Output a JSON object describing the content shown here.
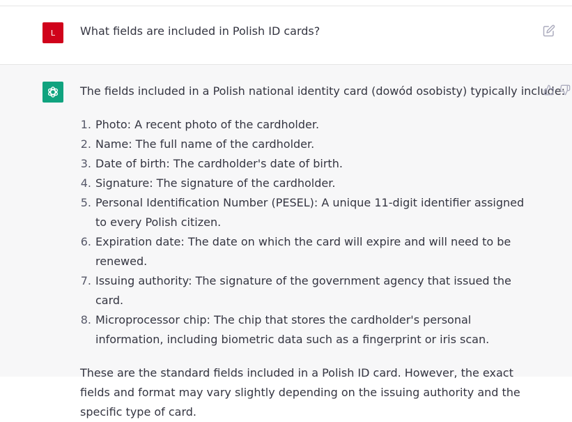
{
  "user_message": {
    "avatar_letter": "L",
    "avatar_color": "#d0021b",
    "text": "What fields are included in Polish ID cards?",
    "edit_icon": "edit-icon"
  },
  "assistant_message": {
    "avatar_icon": "openai-logo-icon",
    "avatar_color": "#10a37f",
    "intro": "The fields included in a Polish national identity card (dowód osobisty) typically include:",
    "items": [
      {
        "num": "1.",
        "text": "Photo: A recent photo of the cardholder."
      },
      {
        "num": "2.",
        "text": "Name: The full name of the cardholder."
      },
      {
        "num": "3.",
        "text": "Date of birth: The cardholder's date of birth."
      },
      {
        "num": "4.",
        "text": "Signature: The signature of the cardholder."
      },
      {
        "num": "5.",
        "text": "Personal Identification Number (PESEL): A unique 11-digit identifier assigned to every Polish citizen."
      },
      {
        "num": "6.",
        "text": "Expiration date: The date on which the card will expire and will need to be renewed."
      },
      {
        "num": "7.",
        "text": "Issuing authority: The signature of the government agency that issued the card."
      },
      {
        "num": "8.",
        "text": "Microprocessor chip: The chip that stores the cardholder's personal information, including biometric data such as a fingerprint or iris scan."
      }
    ],
    "outro": "These are the standard fields included in a Polish ID card. However, the exact fields and format may vary slightly depending on the issuing authority and the specific type of card.",
    "feedback_icons": [
      "thumbs-up-icon",
      "thumbs-down-icon"
    ]
  }
}
